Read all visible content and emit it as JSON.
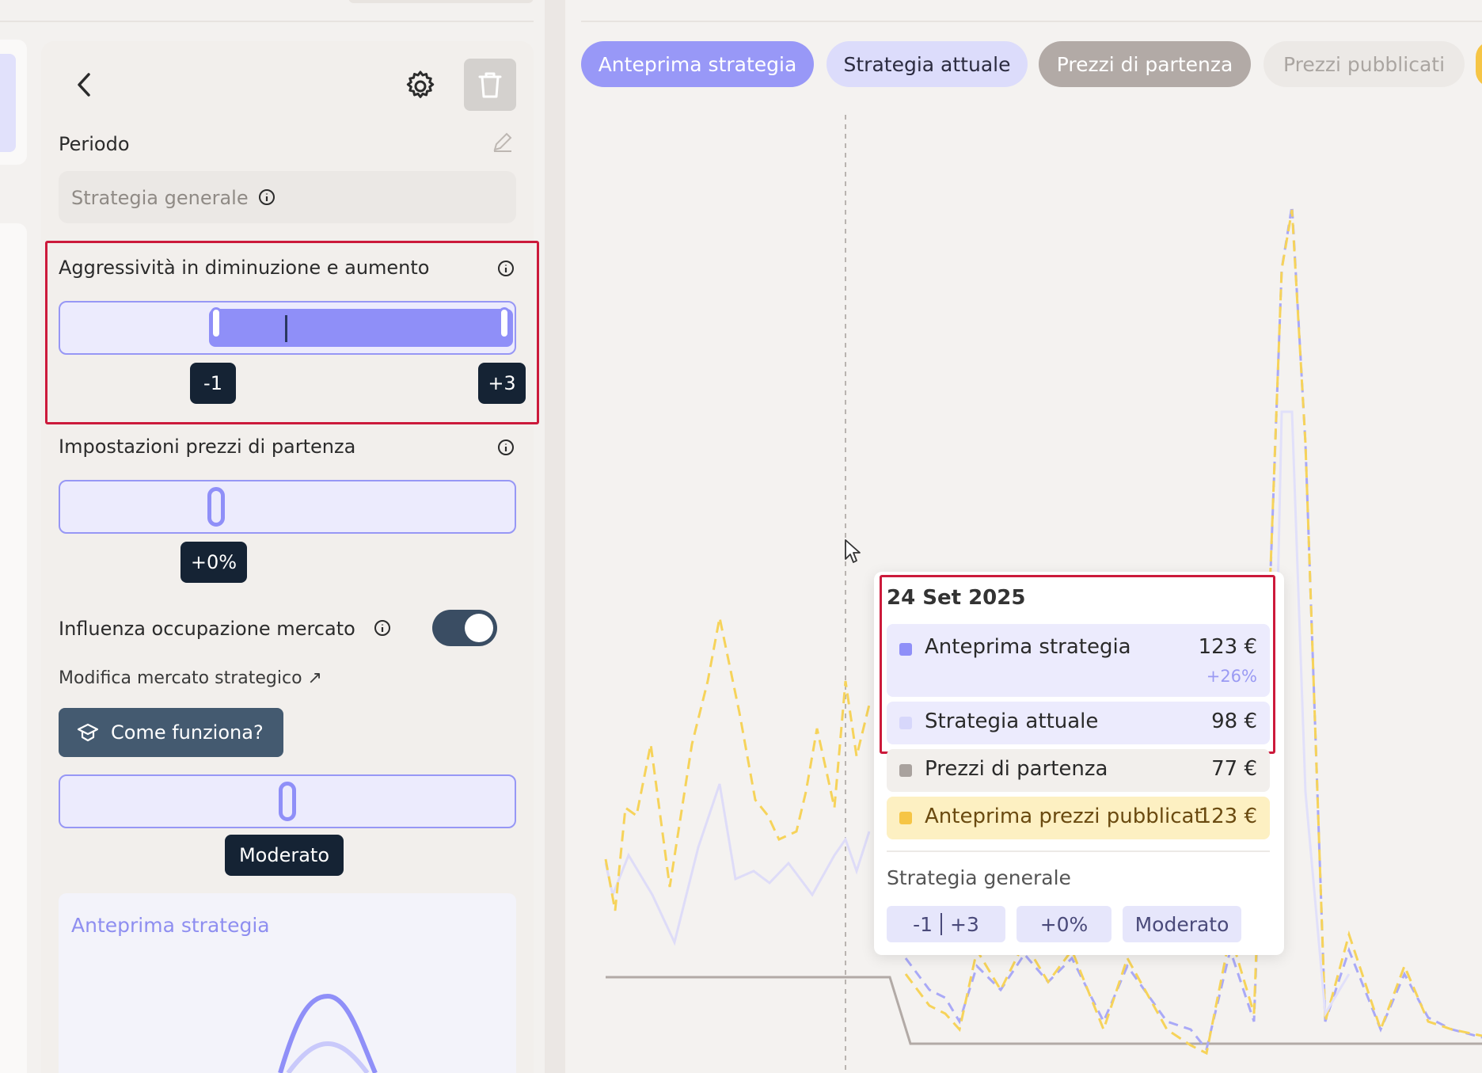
{
  "panel": {
    "period_label": "Periodo",
    "strategy_select": "Strategia generale",
    "aggressiveness_label": "Aggressività in diminuzione e aumento",
    "aggr_min": "-1",
    "aggr_max": "+3",
    "base_price_label": "Impostazioni prezzi di partenza",
    "base_price_value": "+0%",
    "market_influence_label": "Influenza occupazione mercato",
    "market_influence_on": true,
    "edit_market_link": "Modifica mercato strategico ↗",
    "how_it_works": "Come funziona?",
    "market_level": "Moderato",
    "preview_title": "Anteprima strategia"
  },
  "legend": [
    "Anteprima strategia",
    "Strategia attuale",
    "Prezzi di partenza",
    "Prezzi pubblicati"
  ],
  "tooltip": {
    "date": "24 Set 2025",
    "rows": [
      {
        "name": "Anteprima strategia",
        "value": "123 €",
        "delta": "+26%",
        "color": "#8f8ff8"
      },
      {
        "name": "Strategia attuale",
        "value": "98 €",
        "color": "#d7d7fb"
      },
      {
        "name": "Prezzi di partenza",
        "value": "77 €",
        "color": "#a9a29e"
      },
      {
        "name": "Anteprima prezzi pubblicati",
        "value": "123 €",
        "color": "#f6c545"
      }
    ],
    "strategy": "Strategia generale",
    "chips": {
      "min": "-1",
      "max": "+3",
      "base": "+0%",
      "market": "Moderato"
    }
  },
  "colors": {
    "accent": "#8f8ff8",
    "dark": "#152334",
    "highlight": "#cc1a3b",
    "published": "#f6d35a"
  }
}
